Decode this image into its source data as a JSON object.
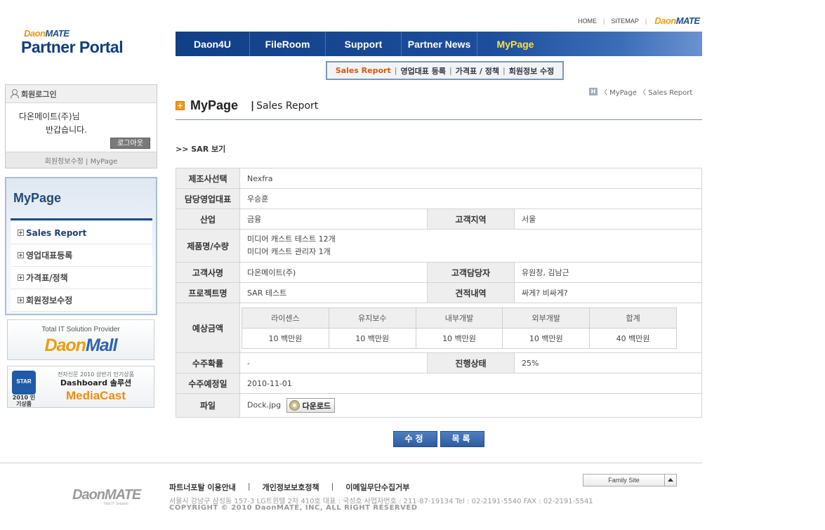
{
  "utility": {
    "home": "HOME",
    "sitemap": "SITEMAP",
    "brand_a": "Daon",
    "brand_b": "MATE"
  },
  "logo": {
    "top_a": "Daon",
    "top_b": "MATE",
    "main": "Partner Portal"
  },
  "gnb": [
    "Daon4U",
    "FileRoom",
    "Support",
    "Partner News",
    "MyPage"
  ],
  "lnb": {
    "items": [
      "Sales Report",
      "영업대표 등록",
      "가격표 / 정책",
      "회원정보 수정"
    ],
    "separator": "|"
  },
  "login": {
    "header": "회원로그인",
    "name": "다온메이트(주)님",
    "welcome": "반갑습니다.",
    "logout": "로그아웃",
    "footer": "회원정보수정 | MyPage"
  },
  "side": {
    "title": "MyPage",
    "items": [
      "Sales Report",
      "영업대표등록",
      "가격표/정책",
      "회원정보수정"
    ]
  },
  "banners": {
    "mall_tagline": "Total IT Solution Provider",
    "mall_a": "Daon",
    "mall_b": "Mall",
    "star_badge": "STAR",
    "star_year": "2010 인기상품",
    "media_top": "전자신문 2010 상반기 인기상품",
    "media_mid": "Dashboard 솔루션",
    "media_name": "MediaCast"
  },
  "breadcrumb": {
    "home": "H",
    "path": "〈 MyPage 〈 Sales Report"
  },
  "title": {
    "main": "MyPage",
    "bar": "|",
    "sub": "Sales Report"
  },
  "section": ">> SAR 보기",
  "detail": {
    "manufacturer_label": "제조사선택",
    "manufacturer": "Nexfra",
    "rep_label": "담당영업대표",
    "rep": "우승훈",
    "industry_label": "산업",
    "industry": "금융",
    "region_label": "고객지역",
    "region": "서울",
    "product_label": "제품명/수량",
    "product_1": "미디어 캐스트 테스트 12개",
    "product_2": "미디어 캐스트 관리자 1개",
    "customer_label": "고객사명",
    "customer": "다온메이트(주)",
    "contact_label": "고객담당자",
    "contact": "유원창, 김남근",
    "project_label": "프로젝트명",
    "project": "SAR 테스트",
    "quote_label": "견적내역",
    "quote": "싸게? 비싸게?",
    "amount_label": "예상금액",
    "amount_headers": [
      "라이센스",
      "유지보수",
      "내부개발",
      "외부개발",
      "합계"
    ],
    "amount_values": [
      "10 백만원",
      "10 백만원",
      "10 백만원",
      "10 백만원",
      "40 백만원"
    ],
    "prob_label": "수주확률",
    "prob": "-",
    "status_label": "진행상태",
    "status": "25%",
    "date_label": "수주예정일",
    "date": "2010-11-01",
    "file_label": "파일",
    "file": "Dock.jpg",
    "download": "다운로드"
  },
  "buttons": {
    "edit": "수정",
    "list": "목록"
  },
  "footer": {
    "links": [
      "파트너포탈 이용안내",
      "개인정보보호정책",
      "이메일무단수집거부"
    ],
    "sep": "|",
    "logo": "DaonMATE",
    "logo_sub": "Total IT Solution",
    "address": "서울시 강남구 삼성동 157-3 LG트윈텔 2차 410호   대표 : 국성호  사업자번호 : 211-87-19134   Tel : 02-2191-5540   FAX : 02-2191-5541",
    "copyright": "COPYRIGHT © 2010 DaonMATE, INC, ALL RIGHT RESERVED",
    "family_site": "Family Site"
  }
}
